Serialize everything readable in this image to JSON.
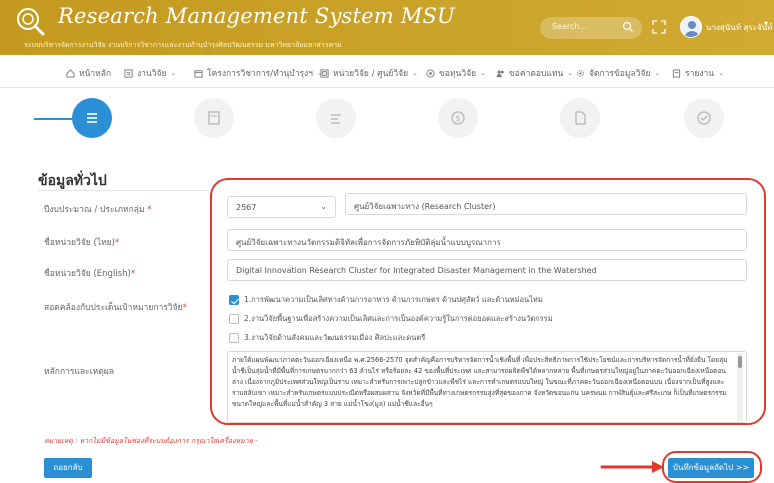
{
  "header": {
    "title": "Research Management System MSU",
    "subtitle": "ระบบบริหารจัดการงานวิจัย งานบริการวิชาการและงานทำนุบำรุงศิลปวัฒนธรรม มหาวิทยาลัยมหาสารคาม",
    "search_placeholder": "Search...",
    "user_name": "นางสุนันท์ สุระจันท์",
    "brand_color": "#c9a227"
  },
  "nav": {
    "items": [
      {
        "label": "หน้าหลัก",
        "icon": "home-icon",
        "dropdown": false
      },
      {
        "label": "งานวิจัย",
        "icon": "list-icon",
        "dropdown": true
      },
      {
        "label": "โครงการวิชาการ/ทำนุบำรุงฯ",
        "icon": "folder-icon",
        "dropdown": true
      },
      {
        "label": "หน่วยวิจัย / ศูนย์วิจัย",
        "icon": "building-icon",
        "dropdown": true
      },
      {
        "label": "ขอทุนวิจัย",
        "icon": "target-icon",
        "dropdown": true
      },
      {
        "label": "ขอค่าตอบแทน",
        "icon": "people-icon",
        "dropdown": true
      },
      {
        "label": "จัดการข้อมูลวิจัย",
        "icon": "settings-icon",
        "dropdown": true
      },
      {
        "label": "รายงาน",
        "icon": "report-icon",
        "dropdown": true
      }
    ]
  },
  "stepper": {
    "active_step": 1,
    "steps": [
      "list-icon",
      "document-icon",
      "checklist-icon",
      "coin-icon",
      "file-icon",
      "check-circle-icon"
    ],
    "accent_color": "#2b8fd6"
  },
  "form": {
    "section_title": "ข้อมูลทั่วไป",
    "fields": {
      "budget_year": {
        "label": "ปีงบประมาณ / ประเภทกลุ่ม",
        "required": true,
        "year_value": "2567",
        "type_value": "ศูนย์วิจัยเฉพาะทาง (Research Cluster)"
      },
      "name_th": {
        "label": "ชื่อหน่วยวิจัย (ไทย)",
        "required": true,
        "value": "ศูนย์วิจัยเฉพาะทางนวัตกรรมดิจิทัลเพื่อการจัดการภัยพิบัติลุ่มน้ำแบบบูรณาการ"
      },
      "name_en": {
        "label": "ชื่อหน่วยวิจัย (English)",
        "required": true,
        "value": "Digital Innovation Research Cluster for Integrated Disaster Management  in the Watershed"
      },
      "alignment": {
        "label": "สอดคล้องกับประเด็นเป้าหมายการวิจัย",
        "required": true,
        "options": [
          {
            "label": "1.การพัฒนาความเป็นเลิศทางด้านการอาหาร ด้านการเกษตร ด้านปศุสัตว์ และด้านหม่อนไหม",
            "checked": true
          },
          {
            "label": "2.งานวิจัยพื้นฐานเพื่อสร้างความเป็นเลิศและการเป็นองค์ความรู้ในการต่อยอดและสร้างนวัตกรรม",
            "checked": false
          },
          {
            "label": "3.งานวิจัยด้านสังคมและวัฒนธรรมเมือง ศิลปะและดนตรี",
            "checked": false
          }
        ]
      },
      "rationale": {
        "label": "หลักการและเหตุผล",
        "required": false,
        "value": "ภายใต้แผนพัฒนาภาคตะวันออกเฉียงเหนือ พ.ศ.2566-2570 จุดสำคัญคือการบริหารจัดการน้ำเชิงพื้นที่ เพื่อประสิทธิภาพการใช้ประโยชน์และการบริหารจัดการน้ำที่ยั่งยืน โดยลุ่มน้ำชีเป็นลุ่มน้ำที่มีพื้นที่การเกษตรมากกว่า 63 ล้านไร่ หรือร้อยละ 42 ของพื้นที่ประเทศ และสามารถผลิตพืชได้หลากหลาย พื้นที่เกษตรส่วนใหญ่อยู่ในภาคตะวันออกเฉียงเหนือตอนล่าง เนื่องจากภูมิประเทศส่วนใหญ่เป็นราบ เหมาะสำหรับการเพาะปลูกข้าวและพืชไร่ และการทำเกษตรแบบใหญ่ ในขณะที่ภาคตะวันออกเฉียงเหนือตอนบน เนื่องจากเป็นที่สูงและราบสลับเขา เหมาะสำหรับเกษตรแบบประณีตหรือผสมผสาน จังหวัดที่มีพื้นที่ทางเกษตรกรรมสูงที่สุดของภาค จังหวัดขอนแก่น นครพนม กาฬสินธุ์และศรีสะเกษ ก็เป็นที่เกษตรกรรมขนาดใหญ่และพื้นที่แม่น้ำสำคัญ 3 สาย แม่น้ำโขง(มูล) แม่น้ำชีและอื่นๆ"
      }
    },
    "note": "หมายเหตุ : หากไม่มีข้อมูลในช่องที่ระบบต้องการ กรุณาใส่เครื่องหมาย -",
    "back_label": "ถอยกลับ",
    "next_label": "บันทึกข้อมูลถัดไป >>",
    "highlight_color": "#e03a2f"
  }
}
